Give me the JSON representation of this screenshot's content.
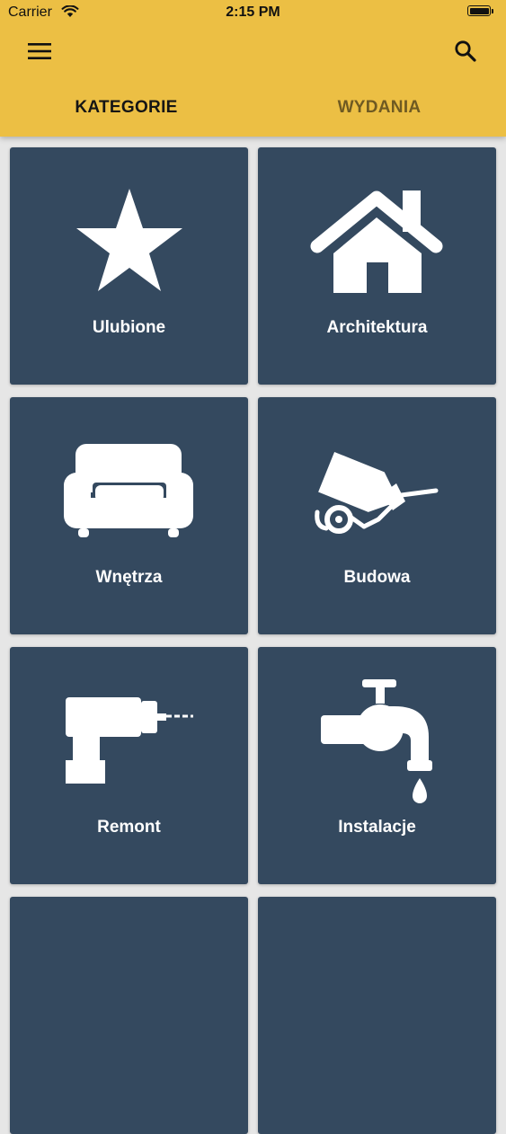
{
  "status_bar": {
    "carrier": "Carrier",
    "time": "2:15 PM"
  },
  "header": {
    "menu_icon": "hamburger-menu-icon",
    "search_icon": "search-icon",
    "background_color": "#ecbf44"
  },
  "tabs": [
    {
      "label": "KATEGORIE",
      "active": true
    },
    {
      "label": "WYDANIA",
      "active": false
    }
  ],
  "categories": [
    {
      "label": "Ulubione",
      "icon": "star-icon"
    },
    {
      "label": "Architektura",
      "icon": "house-icon"
    },
    {
      "label": "Wnętrza",
      "icon": "sofa-icon"
    },
    {
      "label": "Budowa",
      "icon": "concrete-mixer-icon"
    },
    {
      "label": "Remont",
      "icon": "drill-icon"
    },
    {
      "label": "Instalacje",
      "icon": "faucet-icon"
    }
  ],
  "colors": {
    "accent": "#ecbf44",
    "tile": "#34495f",
    "active_tab_text": "#151515",
    "inactive_tab_text": "#6f5a22"
  }
}
